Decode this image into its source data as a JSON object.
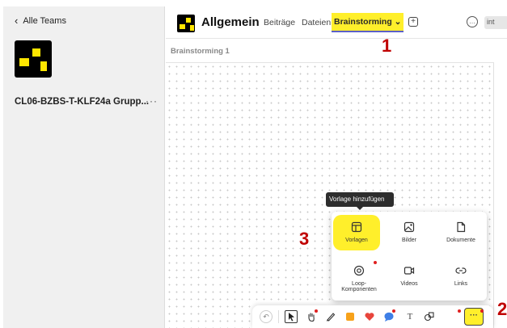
{
  "sidebar": {
    "back_label": "Alle Teams",
    "team_name": "CL06-BZBS-T-KLF24a Grupp...",
    "more": "···"
  },
  "header": {
    "channel_title": "Allgemein",
    "tabs": [
      {
        "label": "Beiträge"
      },
      {
        "label": "Dateien"
      },
      {
        "label": "Brainstorming ⌄"
      }
    ],
    "add_tab": "+",
    "chat": "…",
    "int_label": "int"
  },
  "subheader": {
    "title": "Brainstorming 1"
  },
  "tooltip": "Vorlage hinzufügen",
  "popup": {
    "items": [
      {
        "label": "Vorlagen",
        "icon": "template-icon"
      },
      {
        "label": "Bilder",
        "icon": "image-icon"
      },
      {
        "label": "Dokumente",
        "icon": "document-icon"
      },
      {
        "label": "Loop-\nKomponenten",
        "icon": "loop-icon"
      },
      {
        "label": "Videos",
        "icon": "video-icon"
      },
      {
        "label": "Links",
        "icon": "link-icon"
      }
    ]
  },
  "toolbar": {
    "undo": "↶",
    "text_tool": "T",
    "more": "···"
  },
  "annotations": [
    "1",
    "2",
    "3"
  ],
  "colors": {
    "highlight": "#ffef2b",
    "annotation": "#c00000",
    "accent": "#5b5fc7"
  }
}
